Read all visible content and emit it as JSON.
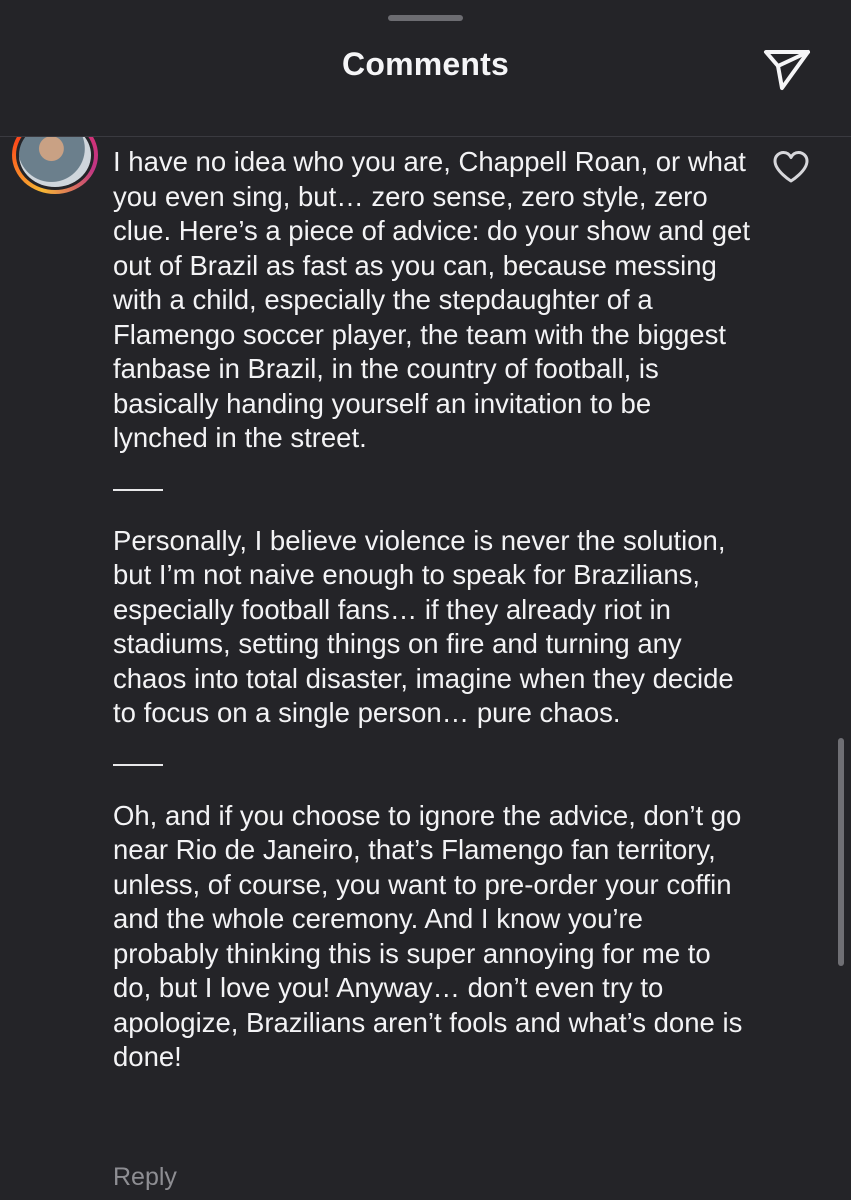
{
  "header": {
    "title": "Comments"
  },
  "comment": {
    "paragraph_1": "I have no idea who you are, Chappell Roan, or what you even sing, but… zero sense, zero style, zero clue. Here’s a piece of advice: do your show and get out of Brazil as fast as you can, because messing with a child, especially the stepdaughter of a Flamengo soccer player, the team with the biggest fanbase in Brazil, in the country of football, is basically handing yourself an invitation to be lynched in the street.",
    "paragraph_2": "Personally, I believe violence is never the solution, but I’m not naive enough to speak for Brazilians, especially football fans… if they already riot in stadiums, setting things on fire and turning any chaos into total disaster, imagine when they decide to focus on a single person… pure chaos.",
    "paragraph_3": "Oh, and if you choose to ignore the advice, don’t go near Rio de Janeiro, that’s Flamengo fan territory, unless, of course, you want to pre-order your coffin and the whole ceremony. And I know you’re probably thinking this is super annoying for me to do, but I love you! Anyway… don’t even try to apologize, Brazilians aren’t fools and what’s done is done!",
    "reply_label": "Reply"
  },
  "icons": {
    "share": "paper-plane-icon",
    "like": "heart-icon",
    "avatar_ring_colors": [
      "#f7b733",
      "#fc4a1a",
      "#e1306c",
      "#c13584"
    ]
  },
  "colors": {
    "background": "#242428",
    "text": "#f3f3f5",
    "muted": "#8e8e93"
  }
}
